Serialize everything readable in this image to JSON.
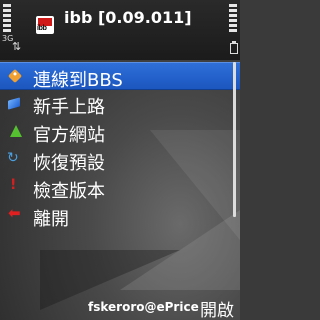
{
  "app": {
    "title": "ibb [0.09.011]",
    "icon_text": "ibb",
    "icon": "ibb-app-icon"
  },
  "status": {
    "network": "3G",
    "icons": [
      "signal-icon",
      "data-transfer-icon",
      "battery-icon"
    ]
  },
  "menu": {
    "selected_index": 0,
    "items": [
      {
        "label": "連線到BBS",
        "icon": "tag-icon"
      },
      {
        "label": "新手上路",
        "icon": "book-icon"
      },
      {
        "label": "官方網站",
        "icon": "website-icon"
      },
      {
        "label": "恢復預設",
        "icon": "restore-icon"
      },
      {
        "label": "檢查版本",
        "icon": "check-version-icon"
      },
      {
        "label": "離開",
        "icon": "exit-icon"
      }
    ]
  },
  "footer": {
    "credit": "fskeroro@ePrice",
    "right_softkey": "開啟"
  },
  "colors": {
    "selection": "#1c56bf",
    "header": "#1b1b1b",
    "text": "#ffffff"
  }
}
